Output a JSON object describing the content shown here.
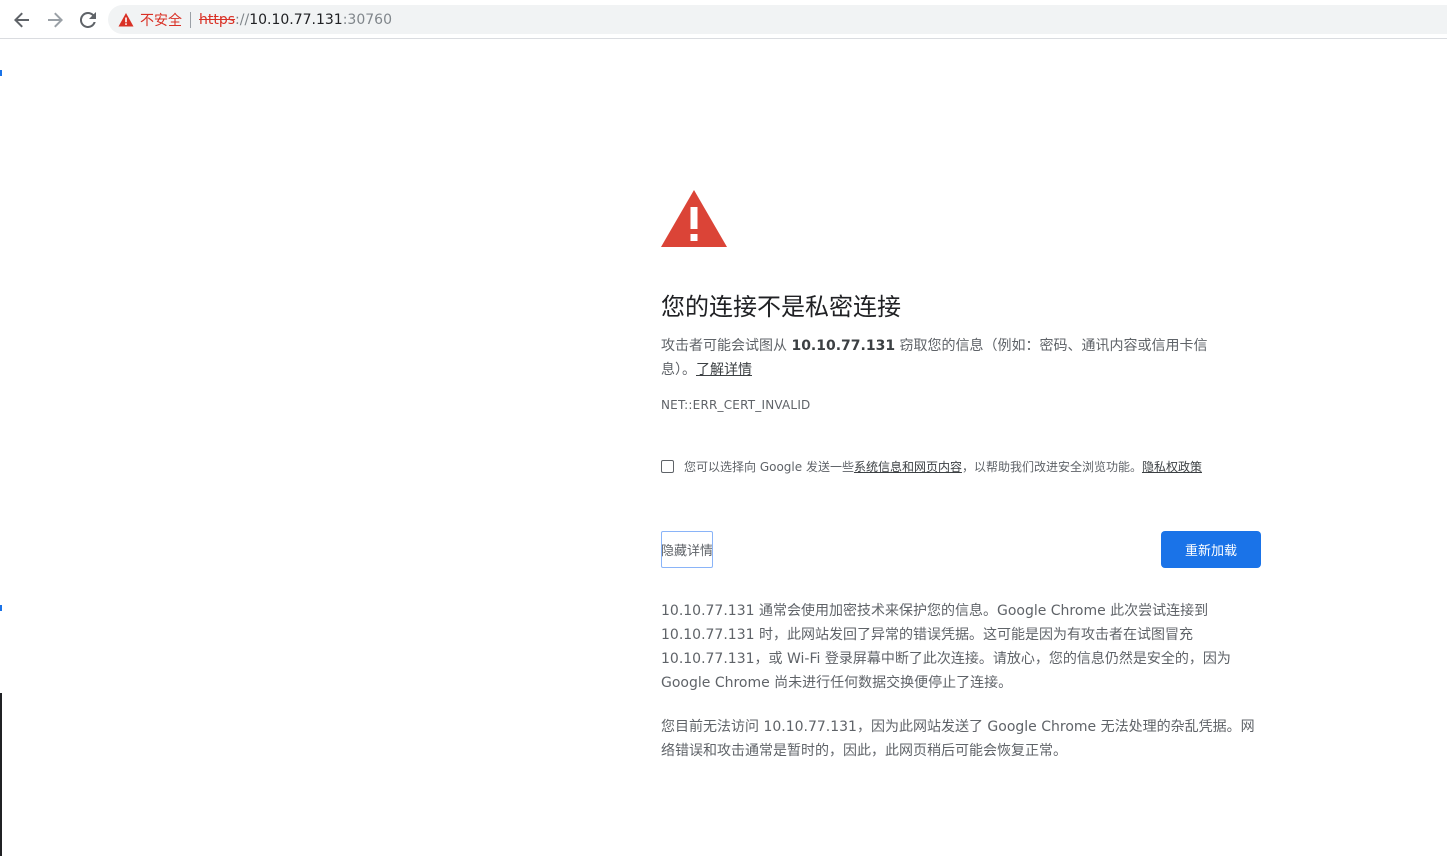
{
  "browser": {
    "security_label": "不安全",
    "url_scheme": "https",
    "url_separator": "://",
    "url_host": "10.10.77.131",
    "url_port": ":30760"
  },
  "colors": {
    "danger": "#d93025",
    "button_blue": "#1a73e8",
    "warning_triangle": "#db4437"
  },
  "interstitial": {
    "heading": "您的连接不是私密连接",
    "primary_prefix": "攻击者可能会试图从 ",
    "primary_host": "10.10.77.131",
    "primary_suffix": " 窃取您的信息（例如：密码、通讯内容或信用卡信息）。",
    "learn_more": "了解详情",
    "error_code": "NET::ERR_CERT_INVALID",
    "optin_prefix": "您可以选择向 Google 发送一些",
    "optin_link": "系统信息和网页内容",
    "optin_middle": "，以帮助我们改进安全浏览功能。",
    "optin_privacy_link": "隐私权政策",
    "details_button": "隐藏详情",
    "reload_button": "重新加载",
    "details_paragraph_1": "10.10.77.131 通常会使用加密技术来保护您的信息。Google Chrome 此次尝试连接到 10.10.77.131 时，此网站发回了异常的错误凭据。这可能是因为有攻击者在试图冒充 10.10.77.131，或 Wi-Fi 登录屏幕中断了此次连接。请放心，您的信息仍然是安全的，因为 Google Chrome 尚未进行任何数据交换便停止了连接。",
    "details_paragraph_2": "您目前无法访问 10.10.77.131，因为此网站发送了 Google Chrome 无法处理的杂乱凭据。网络错误和攻击通常是暂时的，因此，此网页稍后可能会恢复正常。"
  }
}
